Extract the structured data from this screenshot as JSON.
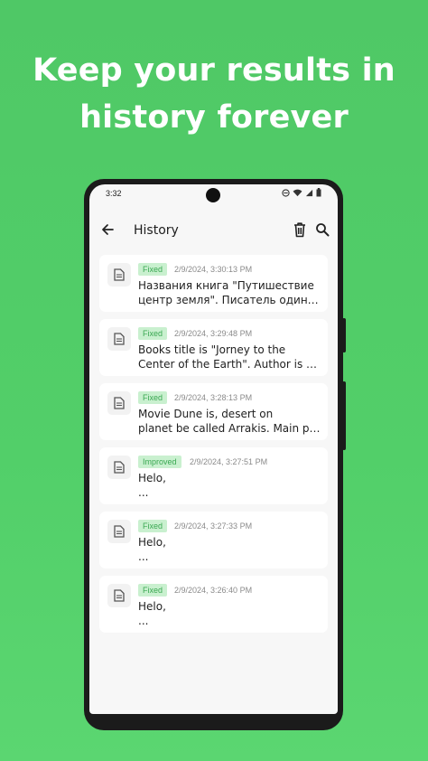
{
  "headline": {
    "line1": "Keep your results in",
    "line2": "history forever"
  },
  "status_bar": {
    "time": "3:32"
  },
  "app_bar": {
    "title": "History"
  },
  "colors": {
    "background": "#52cf69",
    "badge_bg": "#c9f0cf",
    "badge_text": "#3aa852"
  },
  "icons": [
    "back-arrow-icon",
    "trash-icon",
    "search-icon",
    "document-icon"
  ],
  "history": [
    {
      "badge": "Fixed",
      "timestamp": "2/9/2024, 3:30:13 PM",
      "line1": "Названия книга \"Путишествие",
      "line2": "центр земля\". Писатель одино..."
    },
    {
      "badge": "Fixed",
      "timestamp": "2/9/2024, 3:29:48 PM",
      "line1": "Books title is \"Jorney to the",
      "line2": "Center of the Earth\". Author is s..."
    },
    {
      "badge": "Fixed",
      "timestamp": "2/9/2024, 3:28:13 PM",
      "line1": "Movie Dune is, desert on",
      "line2": "planet be called Arrakis. Main pr..."
    },
    {
      "badge": "Improved",
      "timestamp": "2/9/2024, 3:27:51 PM",
      "line1": "Helo,",
      "line2": "..."
    },
    {
      "badge": "Fixed",
      "timestamp": "2/9/2024, 3:27:33 PM",
      "line1": "Helo,",
      "line2": "..."
    },
    {
      "badge": "Fixed",
      "timestamp": "2/9/2024, 3:26:40 PM",
      "line1": "Helo,",
      "line2": "..."
    }
  ]
}
